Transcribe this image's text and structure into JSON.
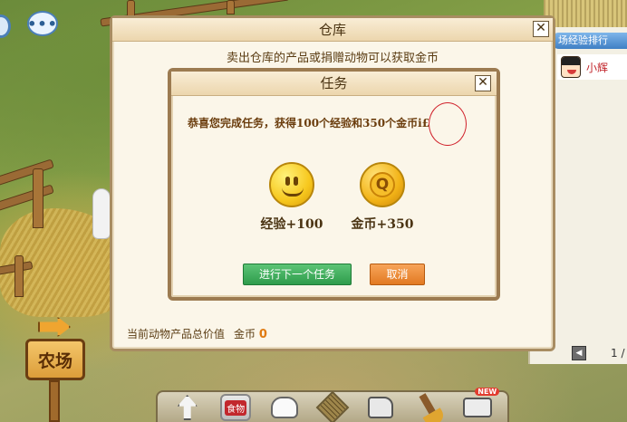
{
  "warehouse": {
    "title": "仓库",
    "close_symbol": "✕",
    "subtitle": "卖出仓库的产品或捐赠动物可以获取金币",
    "footer_label": "当前动物产品总价值",
    "footer_currency": "金币",
    "footer_value": "0"
  },
  "task_dialog": {
    "title": "任务",
    "close_symbol": "✕",
    "message": "恭喜您完成任务，获得100个经验和350个金币i£",
    "rewards": [
      {
        "icon": "smiley-exp-icon",
        "label": "经验+100"
      },
      {
        "icon": "gold-coin-q-icon",
        "label": "金币+350",
        "icon_text": "Q"
      }
    ],
    "next_task_label": "进行下一个任务",
    "cancel_label": "取消"
  },
  "side_panel": {
    "ranking_button": "场经验排行",
    "friend_name": "小辉",
    "pager_prev_symbol": "◀",
    "pager_text": "1 /"
  },
  "farm_sign": {
    "label": "农场"
  },
  "toolbar": {
    "food_label": "食物",
    "new_badge": "NEW",
    "tools": [
      "arrow-cursor-icon",
      "food-bag-icon",
      "glove-hand-icon",
      "net-icon",
      "hammer-icon",
      "broom-icon",
      "camera-icon"
    ]
  },
  "chat": {
    "bubble_text": "•••"
  },
  "colors": {
    "dialog_border": "#9c7b51",
    "dialog_bg": "#fbf6e9",
    "next_button": "#2f9c4c",
    "cancel_button": "#e27a22",
    "coin_value": "#e07a10",
    "annotation_circle": "#d0202a"
  }
}
